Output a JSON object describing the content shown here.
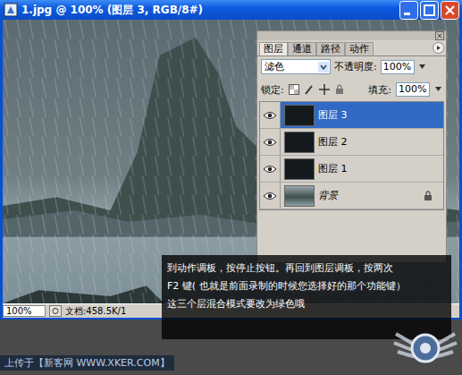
{
  "window": {
    "title": "1.jpg @ 100% (图层 3, RGB/8#)"
  },
  "layers_panel": {
    "tabs": [
      {
        "label": "图层",
        "selected": true
      },
      {
        "label": "通道",
        "selected": false
      },
      {
        "label": "路径",
        "selected": false
      },
      {
        "label": "动作",
        "selected": false
      }
    ],
    "blend_mode": "滤色",
    "opacity_label": "不透明度:",
    "opacity": "100%",
    "lock_label": "锁定:",
    "fill_label": "填充:",
    "fill": "100%",
    "layers": [
      {
        "name": "图层 3",
        "selected": true,
        "visible": true,
        "locked": false,
        "kind": "layer"
      },
      {
        "name": "图层 2",
        "selected": false,
        "visible": true,
        "locked": false,
        "kind": "layer"
      },
      {
        "name": "图层 1",
        "selected": false,
        "visible": true,
        "locked": false,
        "kind": "layer"
      },
      {
        "name": "背景",
        "selected": false,
        "visible": true,
        "locked": true,
        "kind": "background"
      }
    ]
  },
  "status_bar": {
    "zoom": "100%",
    "doc": "文档:458.5K/1"
  },
  "caption": {
    "lines": [
      "到动作调板，按停止按钮。再回到图层调板，按两次",
      "F2 键( 也就是前面录制的时候您选择好的那个功能键）",
      "这三个层混合模式要改为绿色哦"
    ]
  },
  "footer": {
    "text": "上传于【新客网 WWW.XKER.COM】"
  }
}
